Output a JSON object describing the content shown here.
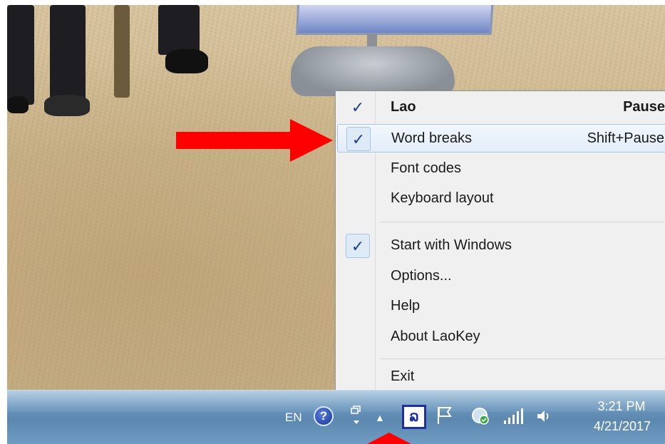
{
  "menu": {
    "items": [
      {
        "label": "Lao",
        "shortcut": "Pause",
        "checked": true
      },
      {
        "label": "Word breaks",
        "shortcut": "Shift+Pause",
        "checked": true,
        "highlighted": true
      },
      {
        "label": "Font codes",
        "shortcut": "",
        "checked": false
      },
      {
        "label": "Keyboard layout",
        "shortcut": "",
        "checked": false
      },
      {
        "label": "Start with Windows",
        "shortcut": "",
        "checked": true
      },
      {
        "label": "Options...",
        "shortcut": "",
        "checked": false
      },
      {
        "label": "Help",
        "shortcut": "",
        "checked": false
      },
      {
        "label": "About LaoKey",
        "shortcut": "",
        "checked": false
      },
      {
        "label": "Exit",
        "shortcut": "",
        "checked": false
      }
    ],
    "check_glyph": "✓"
  },
  "taskbar": {
    "language": "EN",
    "help_icon": "?",
    "show_hidden_icon": "▲",
    "laokey_icon_glyph": "ລ",
    "time": "3:21 PM",
    "date": "4/21/2017"
  },
  "annotations": {
    "arrow_color": "#ff0000"
  },
  "colors": {
    "menu_background": "#f0f0f0",
    "highlight_border": "#aac6ea",
    "taskbar": "#6d99bf"
  }
}
